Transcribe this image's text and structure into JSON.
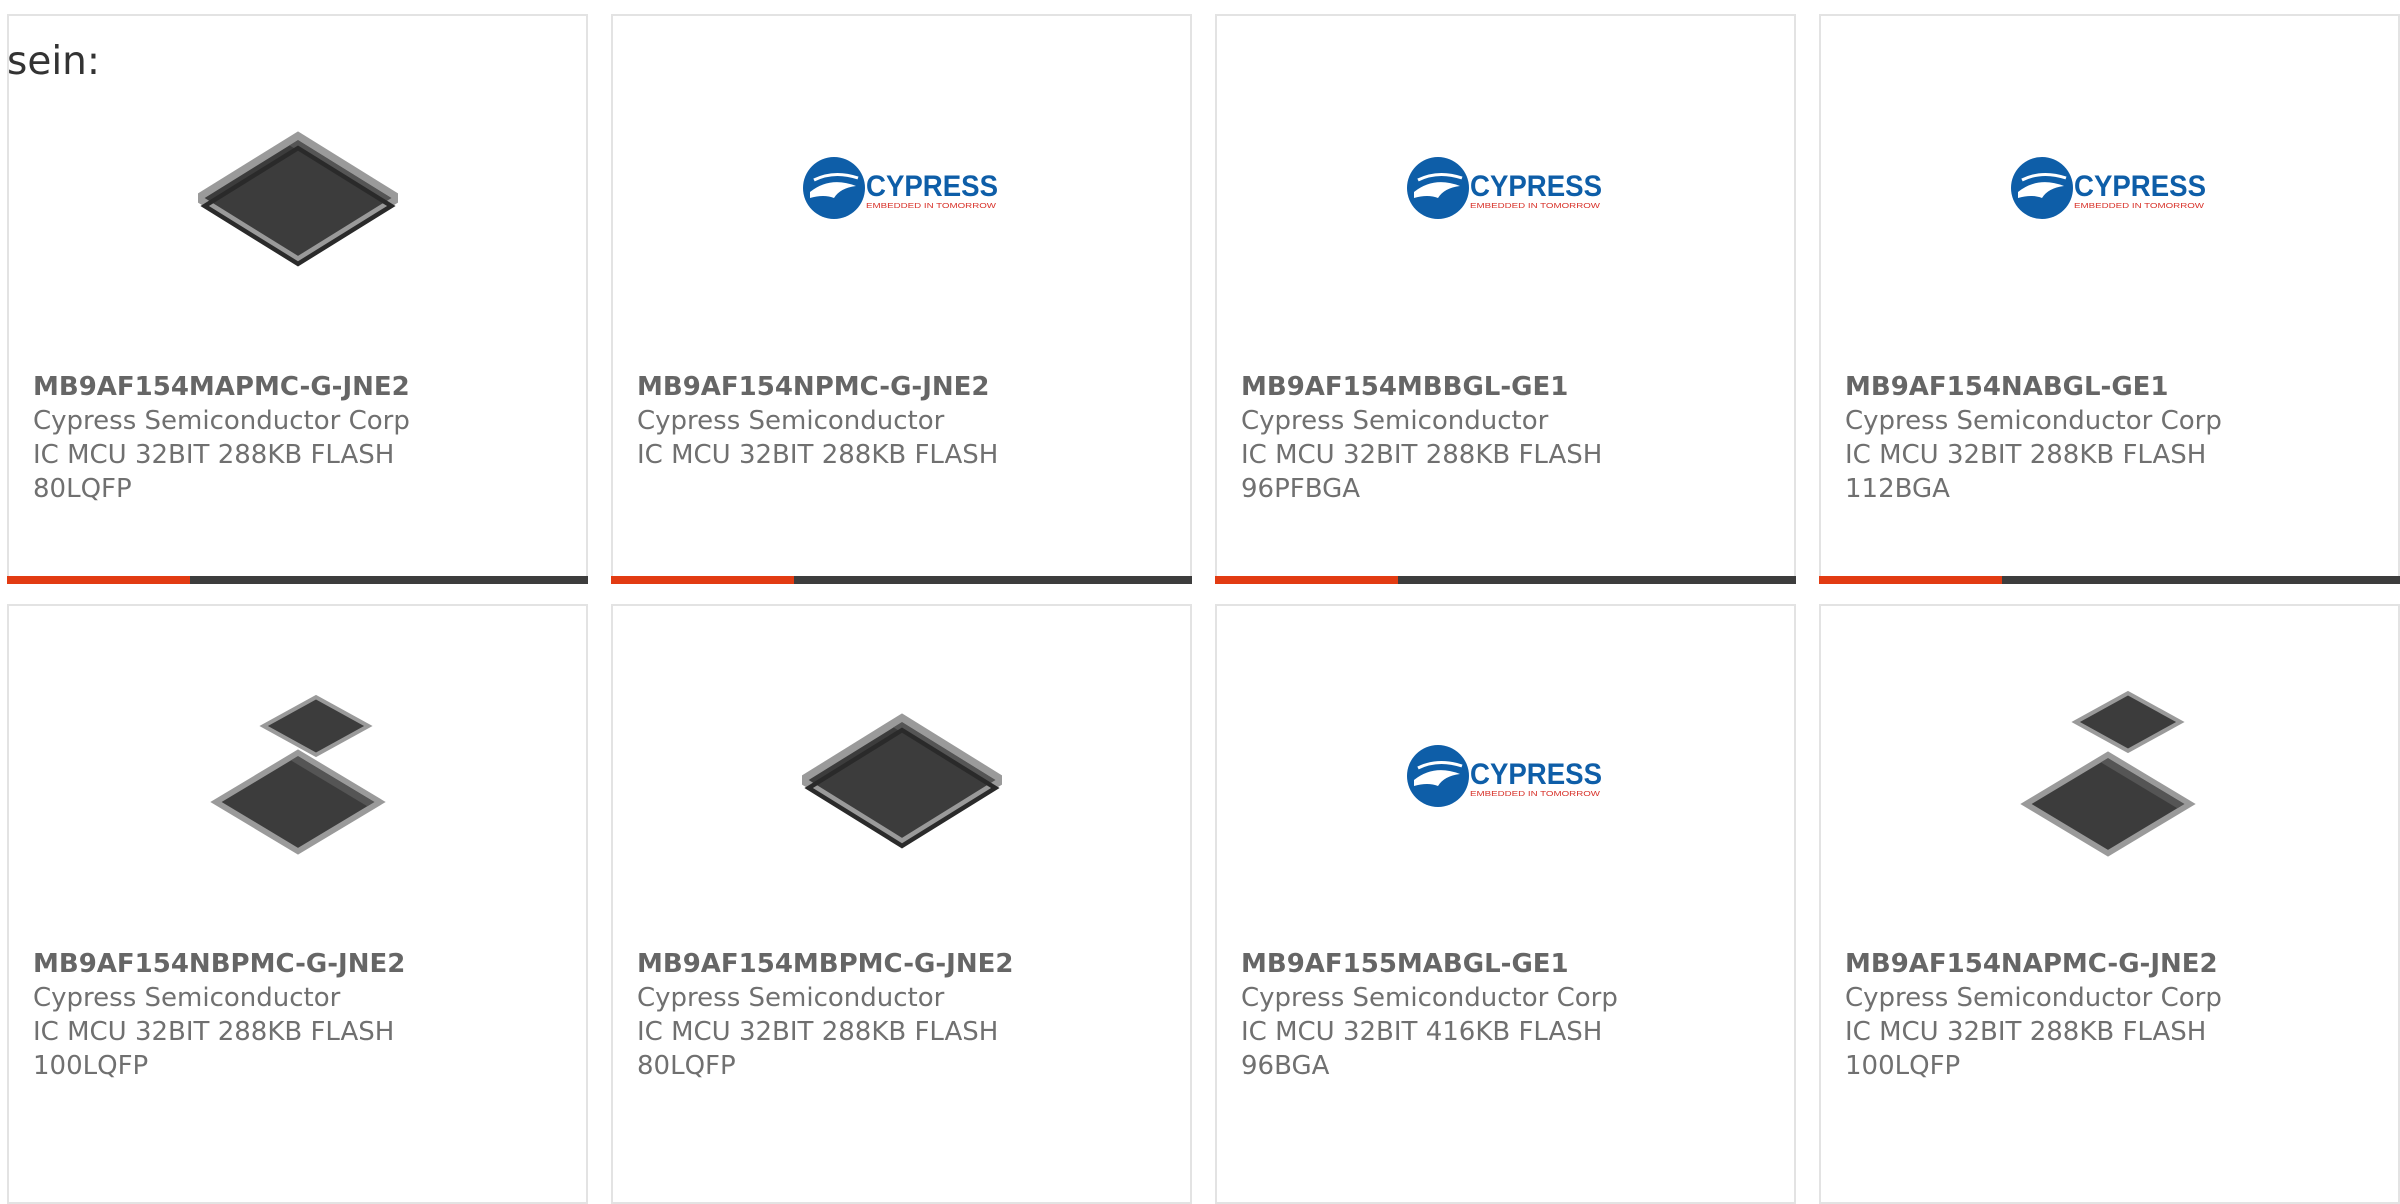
{
  "intro_text": "sein:",
  "colors": {
    "accent": "#e23b12",
    "bar_dark": "#3d3d3d",
    "cypress_blue": "#0e5ea8",
    "chip_dark": "#3c3c3c"
  },
  "cards": [
    {
      "part_number": "MB9AF154MAPMC-G-JNE2",
      "manufacturer": "Cypress Semiconductor Corp",
      "description": "IC MCU 32BIT 288KB FLASH",
      "package": "80LQFP",
      "image": "chip-qfp-icon"
    },
    {
      "part_number": "MB9AF154NPMC-G-JNE2",
      "manufacturer": "Cypress Semiconductor",
      "description": "IC MCU 32BIT 288KB FLASH",
      "package": "",
      "image": "cypress-logo-icon"
    },
    {
      "part_number": "MB9AF154MBBGL-GE1",
      "manufacturer": "Cypress Semiconductor",
      "description": "IC MCU 32BIT 288KB FLASH",
      "package": "96PFBGA",
      "image": "cypress-logo-icon"
    },
    {
      "part_number": "MB9AF154NABGL-GE1",
      "manufacturer": "Cypress Semiconductor Corp",
      "description": "IC MCU 32BIT 288KB FLASH",
      "package": "112BGA",
      "image": "cypress-logo-icon"
    },
    {
      "part_number": "MB9AF154NBPMC-G-JNE2",
      "manufacturer": "Cypress Semiconductor",
      "description": "IC MCU 32BIT 288KB FLASH",
      "package": "100LQFP",
      "image": "chip-pair-icon"
    },
    {
      "part_number": "MB9AF154MBPMC-G-JNE2",
      "manufacturer": "Cypress Semiconductor",
      "description": "IC MCU 32BIT 288KB FLASH",
      "package": "80LQFP",
      "image": "chip-qfp-icon"
    },
    {
      "part_number": "MB9AF155MABGL-GE1",
      "manufacturer": "Cypress Semiconductor Corp",
      "description": "IC MCU 32BIT 416KB FLASH",
      "package": "96BGA",
      "image": "cypress-logo-icon"
    },
    {
      "part_number": "MB9AF154NAPMC-G-JNE2",
      "manufacturer": "Cypress Semiconductor Corp",
      "description": "IC MCU 32BIT 288KB FLASH",
      "package": "100LQFP",
      "image": "chip-pair-icon"
    }
  ],
  "logo": {
    "wordmark": "CYPRESS",
    "tagline": "EMBEDDED IN TOMORROW"
  }
}
